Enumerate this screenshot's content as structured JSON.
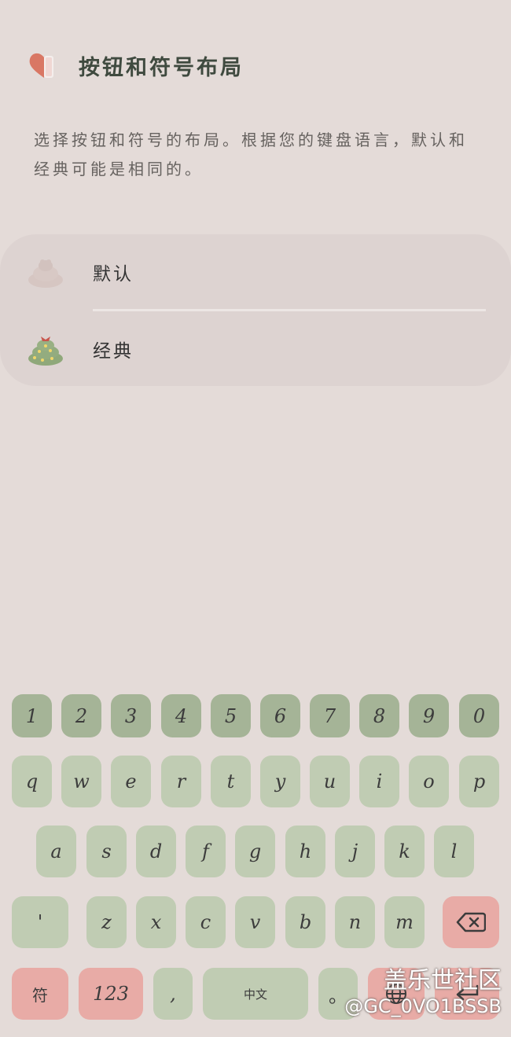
{
  "header": {
    "title": "按钮和符号布局"
  },
  "description": "选择按钮和符号的布局。根据您的键盘语言，默认和经典可能是相同的。",
  "options": [
    {
      "label": "默认",
      "icon": "bun-icon"
    },
    {
      "label": "经典",
      "icon": "christmas-tree-icon"
    }
  ],
  "keyboard": {
    "row_numbers": [
      "1",
      "2",
      "3",
      "4",
      "5",
      "6",
      "7",
      "8",
      "9",
      "0"
    ],
    "row1": [
      "q",
      "w",
      "e",
      "r",
      "t",
      "y",
      "u",
      "i",
      "o",
      "p"
    ],
    "row2": [
      "a",
      "s",
      "d",
      "f",
      "g",
      "h",
      "j",
      "k",
      "l"
    ],
    "row3": {
      "apostrophe": "'",
      "letters": [
        "z",
        "x",
        "c",
        "v",
        "b",
        "n",
        "m"
      ],
      "backspace_icon": "backspace-icon"
    },
    "row4": {
      "symbols": "符",
      "numbers": "123",
      "comma": ",",
      "space": "中文",
      "period": "。",
      "globe_icon": "globe-icon",
      "enter_icon": "enter-icon"
    }
  },
  "watermark": {
    "line1": "盖乐世社区",
    "line2": "@GC_0VO1BSSB"
  },
  "colors": {
    "background": "#e4dbd8",
    "panel": "#ddd3d1",
    "number_keys": "#a5b497",
    "letter_keys": "#c0ccb3",
    "accent_keys": "#e8aba6",
    "logo_red": "#d97764"
  }
}
